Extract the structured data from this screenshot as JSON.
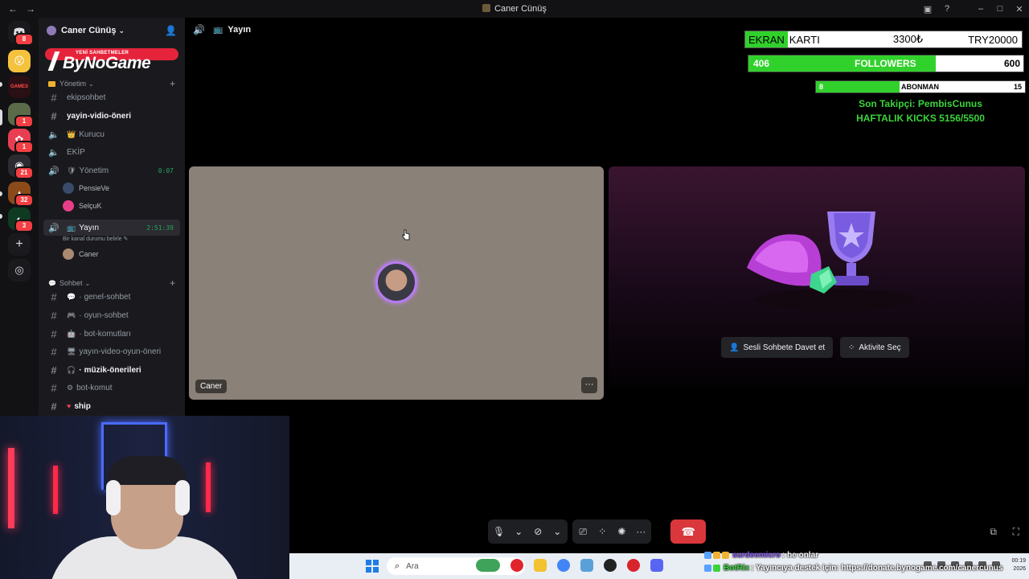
{
  "window": {
    "title": "Caner Cünüş",
    "back": "←",
    "forward": "→"
  },
  "server": {
    "name": "Caner Cünüş",
    "banner_small": "YENİ SAHBETMELER",
    "banner_logo": "ByNoGame"
  },
  "rail_badges": [
    "8",
    "1",
    "1",
    "21",
    "32",
    "3"
  ],
  "categories": {
    "yonetim": "Yönetim",
    "sohbet": "Sohbet"
  },
  "channels": {
    "ekipsohbet": "ekipsohbet",
    "yayin_vidio_oneri": "yayin-vidio-öneri",
    "kurucu": "Kurucu",
    "ekip": "EKİP",
    "yonetim_voice": "Yönetim",
    "yonetim_timer": "0:07",
    "user_pensieve": "PensieVe",
    "user_selcuk": "SelçuK",
    "yayin_voice": "Yayın",
    "yayin_timer": "2:51:39",
    "yayin_status": "Bir kanal durumu belirle",
    "user_caner": "Caner",
    "genel_sohbet": "genel-sohbet",
    "oyun_sohbet": "oyun-sohbet",
    "bot_komutlari": "bot-komutları",
    "yayin_video_oyun_oneri": "yayın-video-oyun-öneri",
    "muzik_onerileri": "müzik-önerileri",
    "bot_komut": "bot-komut",
    "ship": "ship"
  },
  "main": {
    "channel_title": "Yayın"
  },
  "overlay": {
    "ekran_label1": "EKRAN",
    "ekran_label2": "KARTI",
    "ekran_amount": "3300₺",
    "ekran_goal": "TRY20000",
    "followers_current": "406",
    "followers_label": "FOLLOWERS",
    "followers_goal": "600",
    "followers_progress": 0.68,
    "abonman_current": "8",
    "abonman_label": "ABONMAN",
    "abonman_goal": "15",
    "abonman_progress": 0.4,
    "son_takipci": "Son Takipçi: PembisCunus",
    "haftalik_kicks": "HAFTALIK KICKS 5156/5500"
  },
  "tiles": {
    "participant_name": "Caner",
    "more": "···",
    "invite_button": "Sesli Sohbete Davet et",
    "activity_button": "Aktivite Seç"
  },
  "taskbar": {
    "search_placeholder": "Ara",
    "time": "00:19",
    "date": "2026"
  },
  "chat": [
    {
      "user": "surdeemicro",
      "text": ": he onlar"
    },
    {
      "user": "BotRix",
      "text": ": Yayıncıya destek için: https://donate.bynogame.com/canercunus"
    }
  ]
}
